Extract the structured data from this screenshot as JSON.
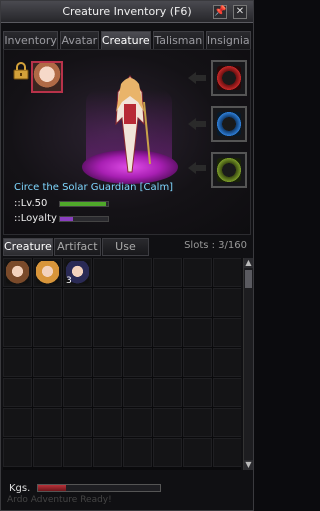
{
  "window": {
    "title": "Creature Inventory (F6)",
    "pin_icon": "pin-icon",
    "close_icon": "close-icon"
  },
  "tabs": [
    {
      "label": "Inventory"
    },
    {
      "label": "Avatar"
    },
    {
      "label": "Creature",
      "active": true
    },
    {
      "label": "Talisman"
    },
    {
      "label": "Insignia"
    }
  ],
  "pet": {
    "name": "Circe the Solar Guardian [Calm]",
    "level_label": "::Lv.50",
    "level_progress": 0.95,
    "loyalty_label": "::Loyalty",
    "loyalty_progress": 0.28,
    "colors": {
      "level_bar": "#4fa82a",
      "loyalty_bar": "#8a3fc0",
      "name": "#7fd7ff",
      "platform": "#c43bcf"
    }
  },
  "equip_slots": [
    {
      "name": "red-slot",
      "color": "#c42828"
    },
    {
      "name": "blue-slot",
      "color": "#2f7fd8"
    },
    {
      "name": "green-slot",
      "color": "#7a9a2a"
    }
  ],
  "subtabs": [
    {
      "label": "Creature",
      "active": true
    },
    {
      "label": "Artifact"
    },
    {
      "label": "Use"
    }
  ],
  "slots_text": "Slots : 3/160",
  "items": [
    {
      "icon": "brown-hair-creature-icon",
      "color": "#7a4a2a",
      "qty": ""
    },
    {
      "icon": "orange-bun-creature-icon",
      "color": "#d8953a",
      "qty": ""
    },
    {
      "icon": "dark-hair-creature-icon",
      "color": "#2a2a55",
      "qty": "3"
    }
  ],
  "weight": {
    "label": "Kgs.",
    "fraction": 0.23
  },
  "footer_text": "Ardo Adventure Ready!"
}
